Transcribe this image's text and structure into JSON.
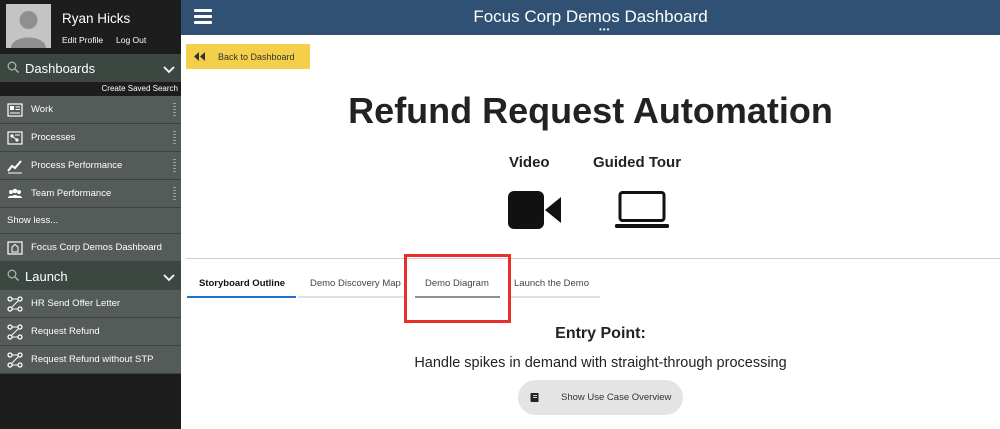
{
  "user": {
    "name": "Ryan Hicks",
    "edit_profile": "Edit Profile",
    "log_out": "Log Out"
  },
  "sidebar": {
    "dashboards_label": "Dashboards",
    "create_saved_search": "Create Saved Search",
    "items": [
      {
        "label": "Work",
        "icon": "work-icon"
      },
      {
        "label": "Processes",
        "icon": "processes-icon"
      },
      {
        "label": "Process Performance",
        "icon": "chart-icon"
      },
      {
        "label": "Team Performance",
        "icon": "team-icon"
      }
    ],
    "show_less": "Show less...",
    "dashboard_item": {
      "label": "Focus Corp Demos Dashboard",
      "icon": "dashboard-icon"
    },
    "launch_label": "Launch",
    "launch_items": [
      {
        "label": "HR Send Offer Letter",
        "icon": "process-flow-icon"
      },
      {
        "label": "Request Refund",
        "icon": "process-flow-icon"
      },
      {
        "label": "Request Refund without STP",
        "icon": "process-flow-icon"
      }
    ]
  },
  "header": {
    "title": "Focus Corp Demos Dashboard",
    "dots": "•••"
  },
  "main": {
    "back_button": "Back to Dashboard",
    "title": "Refund Request Automation",
    "video_label": "Video",
    "guided_tour_label": "Guided Tour",
    "tabs": [
      {
        "label": "Storyboard Outline",
        "active": true
      },
      {
        "label": "Demo Discovery Map",
        "active": false
      },
      {
        "label": "Demo Diagram",
        "active": false
      },
      {
        "label": "Launch the Demo",
        "active": false
      }
    ],
    "entry_title": "Entry Point:",
    "entry_subtitle": "Handle spikes in demand with straight-through processing",
    "use_case_button": "Show Use Case Overview"
  },
  "colors": {
    "header": "#305173",
    "sidebar_section": "#3c4742",
    "sidebar_item": "#555b58",
    "back_button": "#f3cf4a",
    "active_tab": "#1e6fd9",
    "highlight": "#e8302a"
  }
}
